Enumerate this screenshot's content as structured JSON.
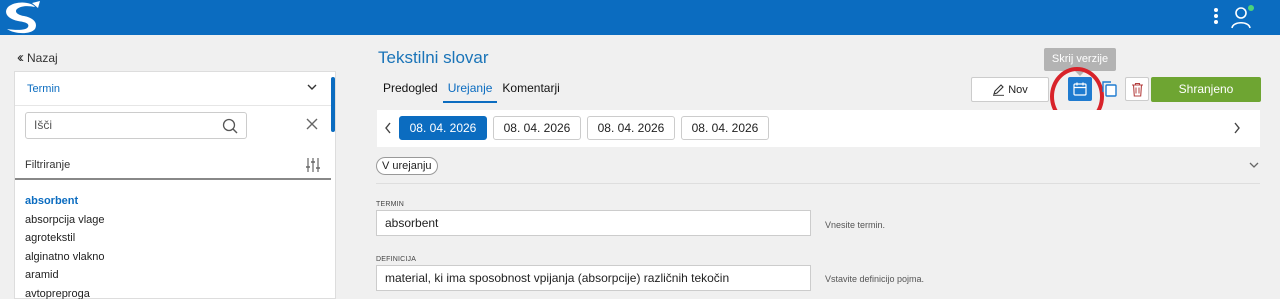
{
  "header": {
    "logo": "logo-icon",
    "menu_icon": "more-vertical-icon",
    "user_icon": "user-icon"
  },
  "sidebar": {
    "back_label": "Nazaj",
    "panel_title": "Termin",
    "search": {
      "placeholder": "Išči",
      "value": ""
    },
    "filter_label": "Filtriranje",
    "terms": [
      "absorbent",
      "absorpcija vlage",
      "agrotekstil",
      "alginatno vlakno",
      "aramid",
      "avtopreproga"
    ],
    "active_term": "absorbent"
  },
  "main": {
    "title": "Tekstilni slovar",
    "tabs": [
      {
        "label": "Predogled",
        "active": false
      },
      {
        "label": "Urejanje",
        "active": true
      },
      {
        "label": "Komentarji",
        "active": false
      }
    ],
    "toolbar": {
      "new_label": "Nov",
      "versions_tooltip": "Skrij verzije",
      "save_label": "Shranjeno"
    },
    "versions": [
      "08. 04. 2026",
      "08. 04. 2026",
      "08. 04. 2026",
      "08. 04. 2026"
    ],
    "status_chip": "V urejanju",
    "fields": [
      {
        "label": "TERMIN",
        "value": "absorbent",
        "hint": "Vnesite termin."
      },
      {
        "label": "DEFINICIJA",
        "value": "material, ki ima sposobnost vpijanja (absorpcije) različnih tekočin",
        "hint": "Vstavite definicijo pojma."
      }
    ]
  },
  "colors": {
    "brand": "#0b6cc0",
    "save": "#6ea532",
    "highlight": "#d8232a"
  }
}
